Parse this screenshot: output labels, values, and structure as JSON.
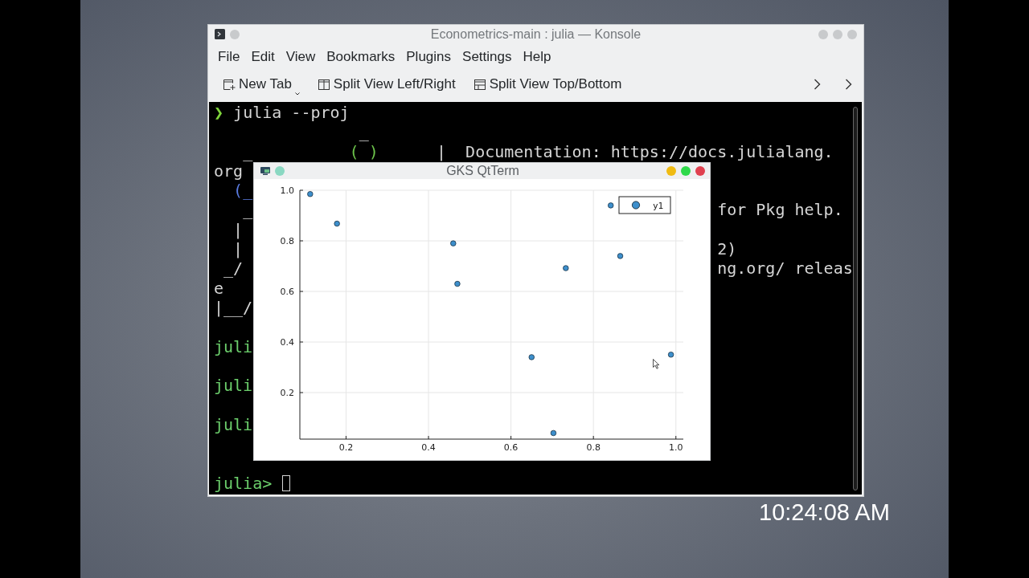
{
  "desktop": {
    "clock": "10:24:08 AM"
  },
  "konsole": {
    "title": "Econometrics-main : julia — Konsole",
    "menu": [
      "File",
      "Edit",
      "View",
      "Bookmarks",
      "Plugins",
      "Settings",
      "Help"
    ],
    "toolbar": [
      {
        "kind": "new-tab",
        "label": "New Tab"
      },
      {
        "kind": "split-left-right",
        "label": "Split View Left/Right"
      },
      {
        "kind": "split-top-bottom",
        "label": "Split View Top/Bottom"
      }
    ],
    "terminal_lines": [
      {
        "kind": "text",
        "segments": [
          {
            "text": "❯",
            "color": "#7fd43b"
          },
          {
            "text": " julia --proj"
          }
        ]
      },
      {
        "kind": "text",
        "segments": [
          {
            "text": "               _"
          }
        ]
      },
      {
        "kind": "text",
        "segments": [
          {
            "text": "   _"
          },
          {
            "text": "          ( )",
            "color": "#6cc24a"
          },
          {
            "text": "      |  Documentation: https://docs.julialang."
          }
        ]
      },
      {
        "kind": "text",
        "segments": [
          {
            "text": "org"
          }
        ]
      },
      {
        "kind": "text",
        "segments": [
          {
            "text": "  (_",
            "color": "#5a7be0"
          }
        ]
      },
      {
        "kind": "text",
        "segments": [
          {
            "text": "   _"
          },
          {
            "text": "                                                for Pkg help."
          }
        ]
      },
      {
        "kind": "text",
        "segments": [
          {
            "text": "  |"
          }
        ]
      },
      {
        "kind": "text",
        "segments": [
          {
            "text": "  |"
          },
          {
            "text": "                                                 2)"
          }
        ]
      },
      {
        "kind": "text",
        "segments": [
          {
            "text": " _/"
          },
          {
            "text": "                                                 ng.org/ releas"
          }
        ]
      },
      {
        "kind": "text",
        "segments": [
          {
            "text": "e"
          }
        ]
      },
      {
        "kind": "text",
        "segments": [
          {
            "text": "|__/"
          }
        ]
      },
      {
        "kind": "blank"
      },
      {
        "kind": "text",
        "segments": [
          {
            "text": "juli",
            "color": "#6ccf6c"
          }
        ]
      },
      {
        "kind": "blank"
      },
      {
        "kind": "text",
        "segments": [
          {
            "text": "juli",
            "color": "#6ccf6c"
          }
        ]
      },
      {
        "kind": "blank"
      },
      {
        "kind": "text",
        "segments": [
          {
            "text": "juli",
            "color": "#6ccf6c"
          }
        ]
      },
      {
        "kind": "blank"
      },
      {
        "kind": "blank"
      },
      {
        "kind": "input",
        "segments": [
          {
            "text": "julia>",
            "color": "#6ccf6c"
          }
        ]
      }
    ]
  },
  "plot_window": {
    "title": "GKS QtTerm",
    "chart_data": {
      "type": "scatter",
      "grid": true,
      "x": [
        0.113,
        0.178,
        0.46,
        0.47,
        0.65,
        0.703,
        0.733,
        0.842,
        0.865,
        0.988
      ],
      "series": [
        {
          "name": "y1",
          "color": "#3d8fcc",
          "values": [
            0.985,
            0.868,
            0.79,
            0.63,
            0.34,
            0.04,
            0.692,
            0.94,
            0.74,
            0.35
          ]
        }
      ],
      "xlim": [
        0.088,
        1.018
      ],
      "ylim": [
        0.016,
        1.0
      ],
      "xticks": [
        0.2,
        0.4,
        0.6,
        0.8,
        {
          "value": 1.0,
          "label": "1.0"
        }
      ],
      "yticks": [
        0.2,
        0.4,
        0.6,
        0.8,
        {
          "value": 1.0,
          "label": "1.0"
        }
      ]
    }
  }
}
